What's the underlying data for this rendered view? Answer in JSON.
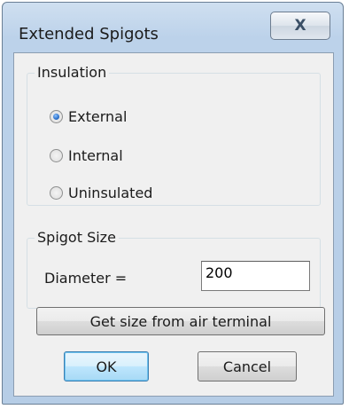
{
  "window": {
    "title": "Extended Spigots",
    "close_glyph": "X"
  },
  "insulation": {
    "legend": "Insulation",
    "options": [
      {
        "label": "External",
        "selected": true
      },
      {
        "label": "Internal",
        "selected": false
      },
      {
        "label": "Uninsulated",
        "selected": false
      }
    ]
  },
  "spigot_size": {
    "legend": "Spigot Size",
    "diameter_label": "Diameter =",
    "diameter_value": "200"
  },
  "buttons": {
    "get_size_label": "Get size from air terminal",
    "ok_label": "OK",
    "cancel_label": "Cancel"
  }
}
